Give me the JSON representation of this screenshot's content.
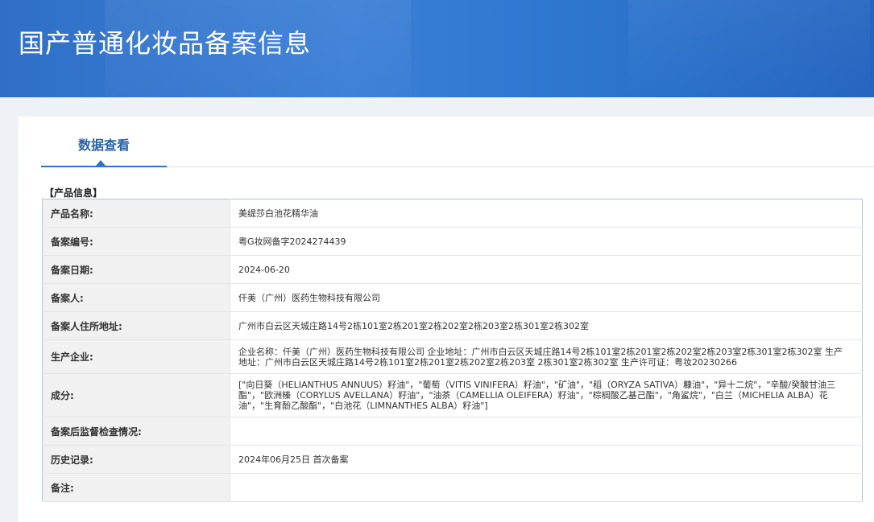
{
  "header": {
    "title": "国产普通化妆品备案信息"
  },
  "tabs": [
    {
      "label": "数据查看"
    }
  ],
  "section": {
    "title": "【产品信息】"
  },
  "rows": [
    {
      "label": "产品名称:",
      "value": "美缇莎白池花精华油"
    },
    {
      "label": "备案编号:",
      "value": "粤G妆网备字2024274439"
    },
    {
      "label": "备案日期:",
      "value": "2024-06-20"
    },
    {
      "label": "备案人:",
      "value": "仟美（广州）医药生物科技有限公司"
    },
    {
      "label": "备案人住所地址:",
      "value": "广州市白云区天城庄路14号2栋101室2栋201室2栋202室2栋203室2栋301室2栋302室"
    },
    {
      "label": "生产企业:",
      "value": "企业名称：仟美（广州）医药生物科技有限公司 企业地址：广州市白云区天城庄路14号2栋101室2栋201室2栋202室2栋203室2栋301室2栋302室 生产地址：广州市白云区天城庄路14号2栋101室2栋201室2栋202室2栋203室 2栋301室2栋302室 生产许可证：粤妆20230266"
    },
    {
      "label": "成分:",
      "value": "[\"向日葵（HELIANTHUS ANNUUS）籽油\"，\"葡萄（VITIS VINIFERA）籽油\"，\"矿油\"，\"稻（ORYZA SATIVA）糠油\"，\"异十二烷\"，\"辛酸/癸酸甘油三酯\"，\"欧洲榛（CORYLUS AVELLANA）籽油\"，\"油茶（CAMELLIA OLEIFERA）籽油\"，\"棕榈酸乙基己酯\"，\"角鲨烷\"，\"白兰（MICHELIA ALBA）花油\"，\"生育酚乙酸酯\"，\"白池花（LIMNANTHES ALBA）籽油\"]"
    },
    {
      "label": "备案后监督检查情况:",
      "value": ""
    },
    {
      "label": "历史记录:",
      "value": "2024年06月25日 首次备案"
    },
    {
      "label": "备注:",
      "value": ""
    }
  ]
}
